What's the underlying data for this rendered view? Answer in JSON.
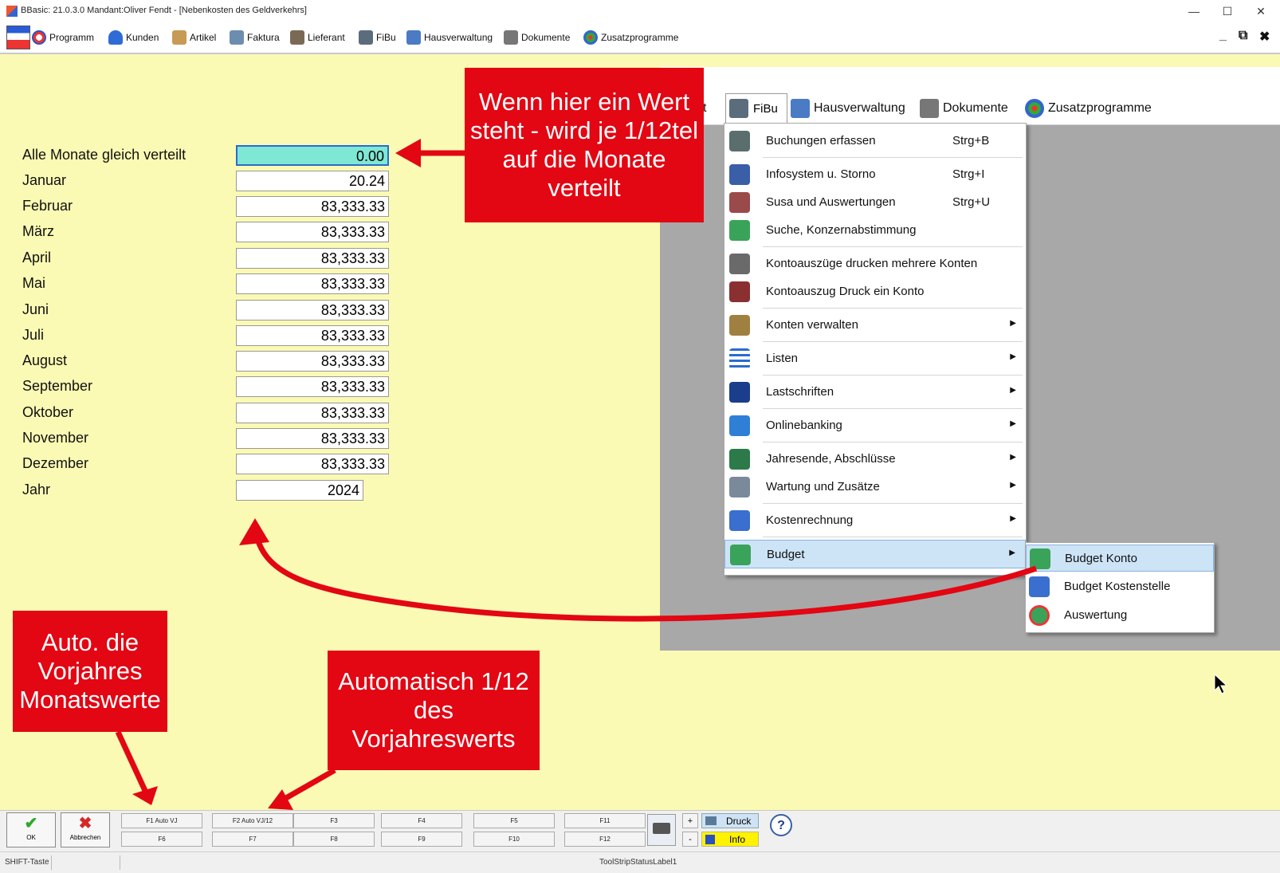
{
  "window": {
    "title": "BBasic: 21.0.3.0 Mandant:Oliver Fendt  - [Nebenkosten des Geldverkehrs]",
    "minimize": "—",
    "maximize": "☐",
    "close": "✕"
  },
  "menubar": {
    "items": [
      "Programm",
      "Kunden",
      "Artikel",
      "Faktura",
      "Lieferant",
      "FiBu",
      "Hausverwaltung",
      "Dokumente",
      "Zusatzprogramme"
    ],
    "mdi_min": "_",
    "mdi_restore": "⧉",
    "mdi_close": "✖"
  },
  "form": {
    "fields": [
      {
        "label": "Alle Monate gleich verteilt",
        "value": "0.00"
      },
      {
        "label": "Januar",
        "value": "20.24"
      },
      {
        "label": "Februar",
        "value": "83,333.33"
      },
      {
        "label": "März",
        "value": "83,333.33"
      },
      {
        "label": "April",
        "value": "83,333.33"
      },
      {
        "label": "Mai",
        "value": "83,333.33"
      },
      {
        "label": "Juni",
        "value": "83,333.33"
      },
      {
        "label": "Juli",
        "value": "83,333.33"
      },
      {
        "label": "August",
        "value": "83,333.33"
      },
      {
        "label": "September",
        "value": "83,333.33"
      },
      {
        "label": "Oktober",
        "value": "83,333.33"
      },
      {
        "label": "November",
        "value": "83,333.33"
      },
      {
        "label": "Dezember",
        "value": "83,333.33"
      },
      {
        "label": "Jahr",
        "value": "2024"
      }
    ]
  },
  "callouts": {
    "top": "Wenn hier ein Wert steht - wird je 1/12tel auf die Monate verteilt",
    "bottom_left": "Auto. die Vorjahres Monatswerte",
    "bottom_mid": "Automatisch 1/12 des Vorjahreswerts"
  },
  "overlay_menubar": {
    "partial": "t",
    "items": [
      "FiBu",
      "Hausverwaltung",
      "Dokumente",
      "Zusatzprogramme"
    ]
  },
  "fibu_menu": {
    "items": [
      {
        "label": "Buchungen erfassen",
        "shortcut": "Strg+B"
      },
      {
        "label": "Infosystem u. Storno",
        "shortcut": "Strg+I"
      },
      {
        "label": "Susa und Auswertungen",
        "shortcut": "Strg+U"
      },
      {
        "label": "Suche, Konzernabstimmung",
        "shortcut": ""
      },
      {
        "label": "Kontoauszüge drucken mehrere Konten",
        "shortcut": ""
      },
      {
        "label": "Kontoauszug Druck ein Konto",
        "shortcut": ""
      },
      {
        "label": "Konten verwalten",
        "shortcut": ""
      },
      {
        "label": "Listen",
        "shortcut": ""
      },
      {
        "label": "Lastschriften",
        "shortcut": ""
      },
      {
        "label": "Onlinebanking",
        "shortcut": ""
      },
      {
        "label": "Jahresende, Abschlüsse",
        "shortcut": ""
      },
      {
        "label": "Wartung und Zusätze",
        "shortcut": ""
      },
      {
        "label": "Kostenrechnung",
        "shortcut": ""
      },
      {
        "label": "Budget",
        "shortcut": ""
      }
    ],
    "submenu_arrow": "▶"
  },
  "budget_submenu": {
    "items": [
      "Budget Konto",
      "Budget Kostenstelle",
      "Auswertung"
    ]
  },
  "toolbar": {
    "ok": "OK",
    "cancel": "Abbrechen",
    "ok_symbol": "✔",
    "cancel_symbol": "✖",
    "fkeys_top": [
      "F1 Auto VJ",
      "F2 Auto VJ/12",
      "F3",
      "F4",
      "F5",
      "F11"
    ],
    "fkeys_bottom": [
      "F6",
      "F7",
      "F8",
      "F9",
      "F10",
      "F12"
    ],
    "plus": "+",
    "minus": "-",
    "druck": "Druck",
    "info": "Info",
    "help": "?"
  },
  "statusbar": {
    "shift": "SHIFT-Taste",
    "label": "ToolStripStatusLabel1"
  },
  "colors": {
    "form_bg": "#fafab4",
    "callout": "#e30613",
    "highlight_input": "#7fe8d4",
    "menu_highlight": "#cde4f7"
  }
}
